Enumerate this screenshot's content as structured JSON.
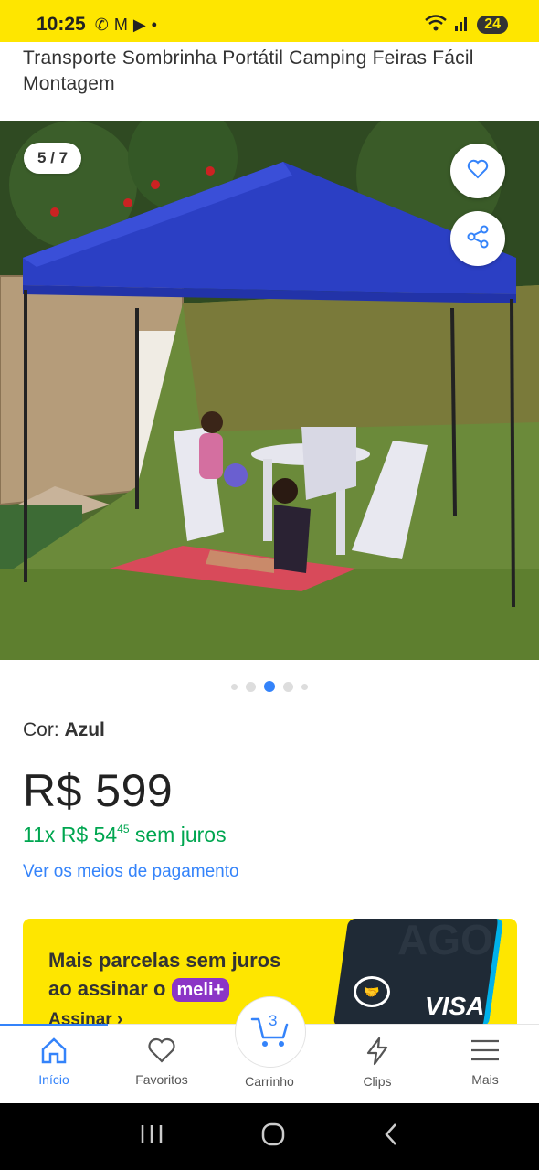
{
  "status_bar": {
    "time": "10:25",
    "battery": "24"
  },
  "product": {
    "title": "Transporte Sombrinha Portátil Camping Feiras Fácil Montagem",
    "image_counter": "5 / 7",
    "carousel": {
      "total_dots": 5,
      "active_index": 2
    },
    "color_label": "Cor:",
    "color_value": "Azul",
    "price": "R$ 599",
    "installments_prefix": "11x R$ 54",
    "installments_cents": "45",
    "installments_suffix": " sem juros",
    "payment_link": "Ver os meios de pagamento"
  },
  "promo": {
    "line1": "Mais parcelas sem juros",
    "line2": "ao assinar o",
    "badge": "meli+",
    "cta": "Assinar",
    "card_brand": "VISA",
    "card_text": "AGO"
  },
  "bottom_nav": {
    "items": [
      {
        "label": "Início",
        "icon": "home-icon",
        "active": true
      },
      {
        "label": "Favoritos",
        "icon": "heart-icon"
      },
      {
        "label": "Carrinho",
        "icon": "cart-icon",
        "badge": "3"
      },
      {
        "label": "Clips",
        "icon": "lightning-icon"
      },
      {
        "label": "Mais",
        "icon": "menu-icon"
      }
    ]
  },
  "colors": {
    "brand_yellow": "#fee600",
    "link_blue": "#3483fa",
    "green": "#00a650",
    "tent_blue": "#2b3fc4"
  }
}
